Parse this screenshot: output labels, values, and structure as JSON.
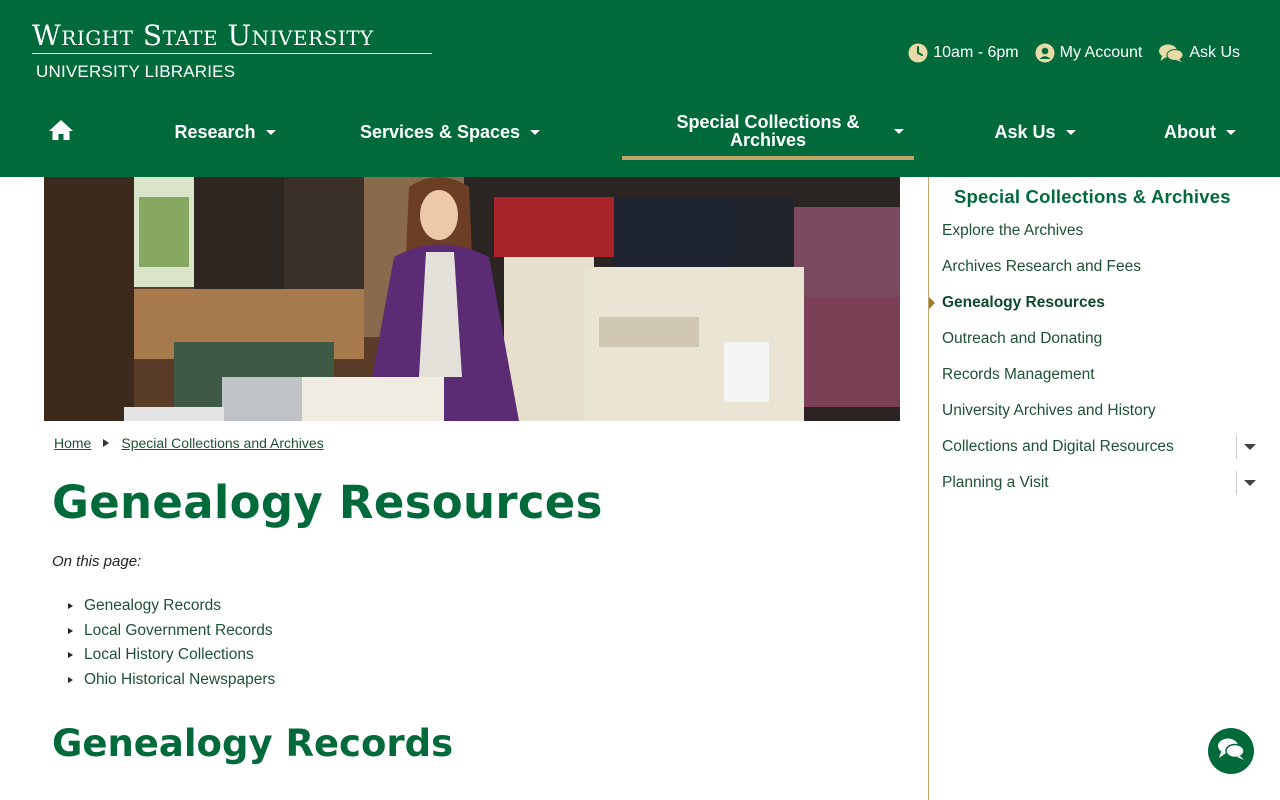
{
  "header": {
    "logo_main": "Wright State University",
    "logo_sub": "UNIVERSITY LIBRARIES",
    "utility": {
      "hours": "10am - 6pm",
      "account": "My Account",
      "ask": "Ask Us"
    }
  },
  "nav": {
    "home_icon": "home-icon",
    "items": [
      {
        "label": "Research"
      },
      {
        "label": "Services & Spaces"
      },
      {
        "label": "Special Collections & Archives"
      },
      {
        "label": "Ask Us"
      },
      {
        "label": "About"
      }
    ]
  },
  "breadcrumb": {
    "home": "Home",
    "section": "Special Collections and Archives"
  },
  "main": {
    "title": "Genealogy Resources",
    "on_this_page": "On this page:",
    "toc": [
      "Genealogy Records",
      "Local Government Records",
      "Local History Collections",
      "Ohio Historical Newspapers"
    ],
    "section_title": "Genealogy Records"
  },
  "sidebar": {
    "title": "Special Collections & Archives",
    "items": [
      {
        "label": "Explore the Archives"
      },
      {
        "label": "Archives Research and Fees"
      },
      {
        "label": "Genealogy Resources",
        "active": true
      },
      {
        "label": "Outreach and Donating"
      },
      {
        "label": "Records Management"
      },
      {
        "label": "University Archives and History"
      },
      {
        "label": "Collections and Digital Resources",
        "expandable": true
      },
      {
        "label": "Planning a Visit",
        "expandable": true
      }
    ]
  },
  "colors": {
    "brand_green": "#006a3b",
    "gold": "#c2a568",
    "link_green": "#1f5135"
  }
}
